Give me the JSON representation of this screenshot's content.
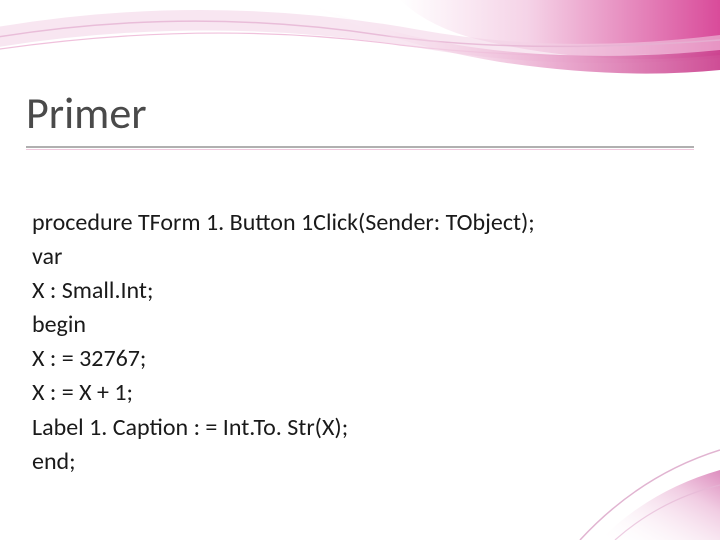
{
  "slide": {
    "title": "Primer",
    "code_lines": [
      "procedure TForm 1. Button 1Click(Sender: TObject);",
      "var",
      "X : Small.Int;",
      "begin",
      "X : = 32767;",
      "X : = X + 1;",
      "Label 1. Caption : = Int.To. Str(X);",
      "end;"
    ]
  },
  "colors": {
    "accent_pink": "#d94b9a",
    "accent_light": "#e9a7cd",
    "text_title": "#4a4a4a",
    "text_body": "#1a1a1a"
  }
}
